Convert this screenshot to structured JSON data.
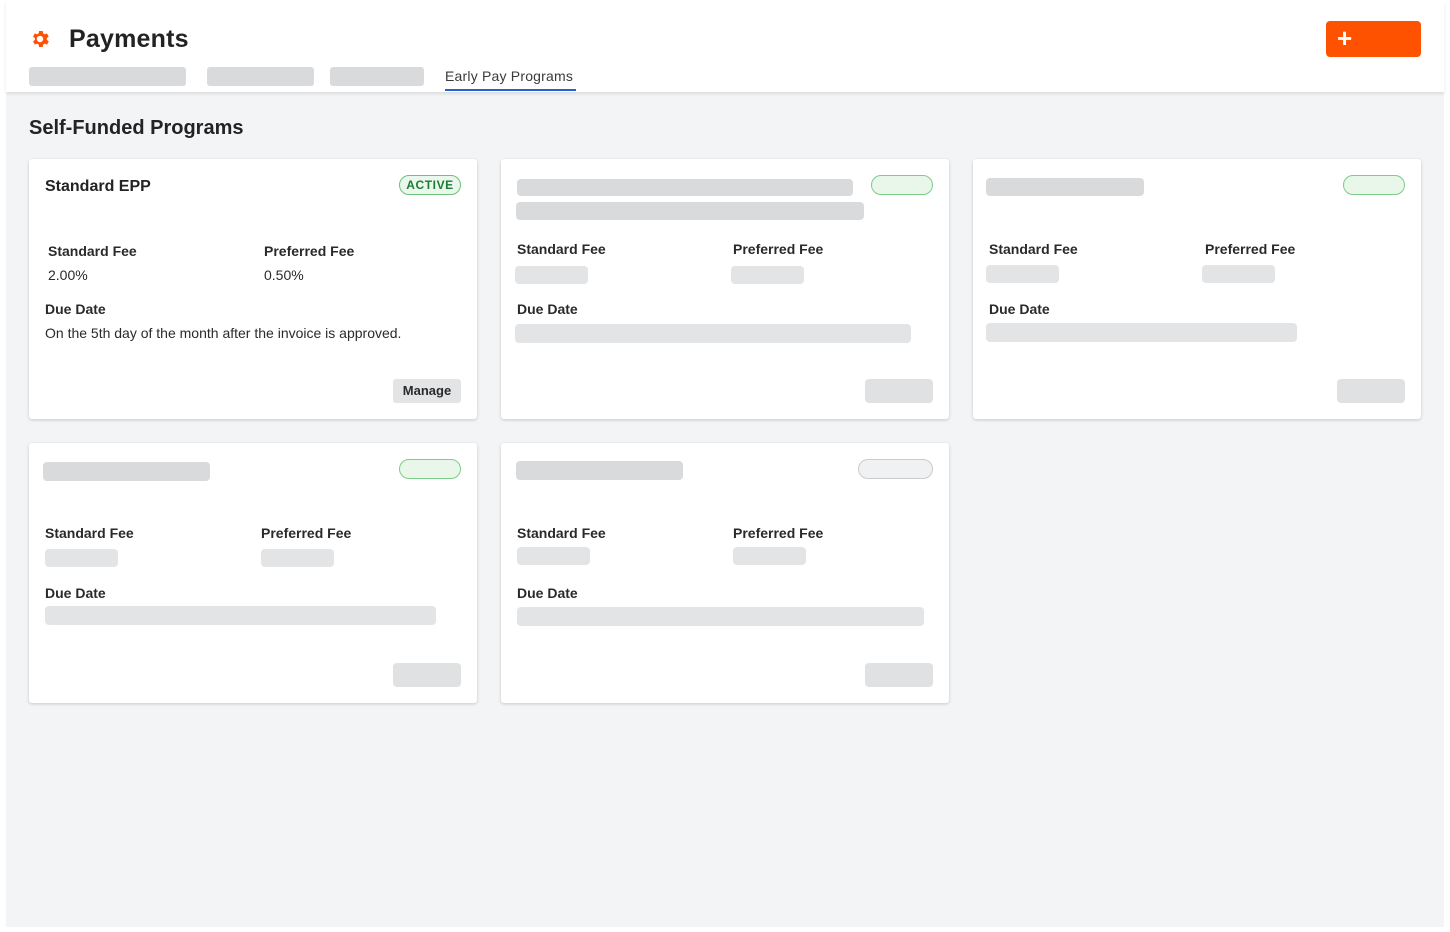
{
  "header": {
    "title": "Payments",
    "icon": "gear-icon",
    "create_button_icon": "plus-icon",
    "accent_color": "#ff5200",
    "tabs": [
      {
        "label": "",
        "loading": true
      },
      {
        "label": "",
        "loading": true
      },
      {
        "label": "",
        "loading": true
      },
      {
        "label": "Early Pay Programs",
        "active": true
      }
    ]
  },
  "section": {
    "title": "Self-Funded Programs"
  },
  "program_cards": [
    {
      "name": "Standard EPP",
      "status": "ACTIVE",
      "standard_fee_label": "Standard Fee",
      "standard_fee": "2.00%",
      "preferred_fee_label": "Preferred Fee",
      "preferred_fee": "0.50%",
      "due_date_label": "Due Date",
      "due_date": "On the 5th day of the month after the invoice is approved.",
      "manage_label": "Manage"
    },
    {
      "loading": true,
      "status_color": "green",
      "standard_fee_label": "Standard Fee",
      "preferred_fee_label": "Preferred Fee",
      "due_date_label": "Due Date"
    },
    {
      "loading": true,
      "status_color": "green",
      "standard_fee_label": "Standard Fee",
      "preferred_fee_label": "Preferred Fee",
      "due_date_label": "Due Date"
    },
    {
      "loading": true,
      "status_color": "green",
      "standard_fee_label": "Standard Fee",
      "preferred_fee_label": "Preferred Fee",
      "due_date_label": "Due Date"
    },
    {
      "loading": true,
      "status_color": "gray",
      "standard_fee_label": "Standard Fee",
      "preferred_fee_label": "Preferred Fee",
      "due_date_label": "Due Date"
    }
  ]
}
